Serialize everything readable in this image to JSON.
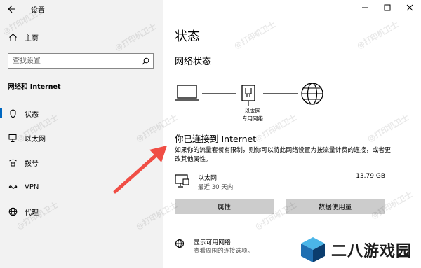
{
  "window": {
    "title": "设置"
  },
  "sidebar": {
    "home_label": "主页",
    "search_placeholder": "查找设置",
    "section_header": "网络和 Internet",
    "items": [
      {
        "label": "状态",
        "icon": "home-status-icon",
        "active": true
      },
      {
        "label": "以太网",
        "icon": "ethernet-icon",
        "active": false
      },
      {
        "label": "拨号",
        "icon": "dialup-icon",
        "active": false
      },
      {
        "label": "VPN",
        "icon": "vpn-icon",
        "active": false
      },
      {
        "label": "代理",
        "icon": "globe-icon",
        "active": false
      }
    ]
  },
  "main": {
    "title": "状态",
    "network_status": "网络状态",
    "network_label": [
      "以太网",
      "专用网络"
    ],
    "connected_title": "你已连接到 Internet",
    "connected_desc": "如果你的流量套餐有限制，则你可以将此网络设置为按流量计费的连接，或者更改其他属性。",
    "ethernet": {
      "name": "以太网",
      "sub": "最近 30 天内",
      "usage": "13.79 GB"
    },
    "buttons": {
      "properties": "属性",
      "data_usage": "数据使用量"
    },
    "available": {
      "title": "显示可用网络",
      "sub": "查看周围的连接选项。"
    }
  },
  "watermark": "@打印机卫士",
  "logo": {
    "text": "二八游戏园"
  },
  "colors": {
    "accent": "#0067c0",
    "arrow": "#f04e45",
    "sidebar_bg": "#f2f2f2",
    "button_bg": "#cccccc"
  }
}
